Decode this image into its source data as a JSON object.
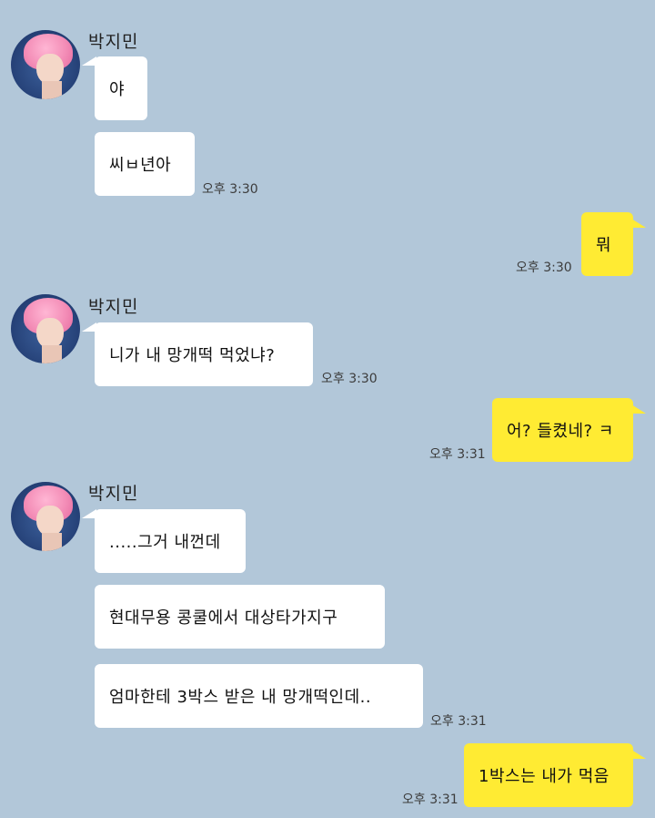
{
  "messages": [
    {
      "sender": "박지민",
      "text": "야"
    },
    {
      "sender": "박지민",
      "text": "씨ㅂ년아",
      "time": "오후 3:30"
    },
    {
      "sender": "me",
      "text": "뭐",
      "time": "오후 3:30"
    },
    {
      "sender": "박지민",
      "text": "니가 내 망개떡 먹었냐?",
      "time": "오후 3:30"
    },
    {
      "sender": "me",
      "text": "어? 들켰네? ㅋ",
      "time": "오후 3:31"
    },
    {
      "sender": "박지민",
      "text": ".....그거 내껀데"
    },
    {
      "sender": "박지민",
      "text": "현대무용 콩쿨에서 대상타가지구"
    },
    {
      "sender": "박지민",
      "text": "엄마한테 3박스 받은 내 망개떡인데..",
      "time": "오후 3:31"
    },
    {
      "sender": "me",
      "text": "1박스는 내가 먹음",
      "time": "오후 3:31"
    }
  ],
  "colors": {
    "background": "#b2c7d9",
    "my_bubble": "#ffeb33",
    "their_bubble": "#ffffff"
  }
}
